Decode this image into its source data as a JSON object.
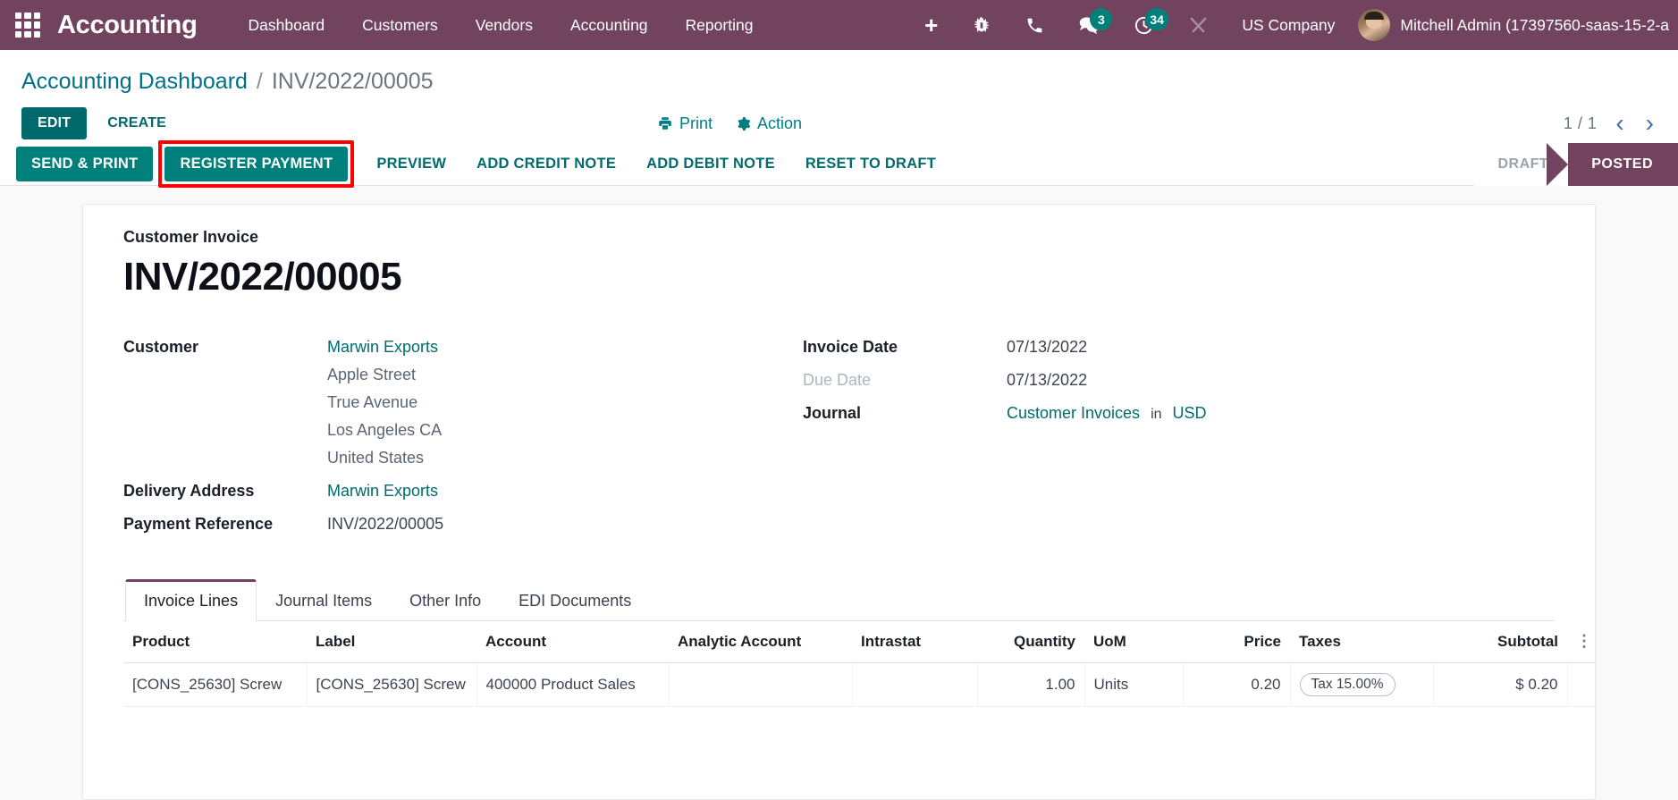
{
  "navbar": {
    "apps_icon": "apps-grid-icon",
    "brand": "Accounting",
    "menu": [
      {
        "label": "Dashboard"
      },
      {
        "label": "Customers"
      },
      {
        "label": "Vendors"
      },
      {
        "label": "Accounting"
      },
      {
        "label": "Reporting"
      }
    ],
    "plus_label": "+",
    "icons": [
      {
        "name": "bug-icon"
      },
      {
        "name": "phone-icon"
      },
      {
        "name": "messages-icon",
        "badge": "3"
      },
      {
        "name": "activities-clock-icon",
        "badge": "34"
      },
      {
        "name": "tools-icon"
      }
    ],
    "company": "US Company",
    "user": "Mitchell Admin (17397560-saas-15-2-a",
    "accent": "#71435f",
    "badge_color": "#00807b"
  },
  "breadcrumb": {
    "root": "Accounting Dashboard",
    "separator": "/",
    "current": "INV/2022/00005"
  },
  "control_panel": {
    "edit_label": "EDIT",
    "create_label": "CREATE",
    "print_label": "Print",
    "action_label": "Action",
    "pager_value": "1 / 1",
    "pager_prev": "‹",
    "pager_next": "›"
  },
  "statusbar": {
    "buttons": [
      {
        "label": "SEND & PRINT",
        "style": "primary",
        "highlighted": false
      },
      {
        "label": "REGISTER PAYMENT",
        "style": "primary",
        "highlighted": true
      },
      {
        "label": "PREVIEW",
        "style": "link",
        "highlighted": false
      },
      {
        "label": "ADD CREDIT NOTE",
        "style": "link",
        "highlighted": false
      },
      {
        "label": "ADD DEBIT NOTE",
        "style": "link",
        "highlighted": false
      },
      {
        "label": "RESET TO DRAFT",
        "style": "link",
        "highlighted": false
      }
    ],
    "stages": [
      {
        "label": "DRAFT",
        "active": false
      },
      {
        "label": "POSTED",
        "active": true
      }
    ],
    "highlight_color": "#ff0000"
  },
  "record": {
    "subtitle": "Customer Invoice",
    "title": "INV/2022/00005",
    "customer_label": "Customer",
    "customer_name": "Marwin Exports",
    "customer_address": [
      "Apple Street",
      "True Avenue",
      "Los Angeles CA",
      "United States"
    ],
    "delivery_address_label": "Delivery Address",
    "delivery_address_value": "Marwin Exports",
    "payment_reference_label": "Payment Reference",
    "payment_reference_value": "INV/2022/00005",
    "invoice_date_label": "Invoice Date",
    "invoice_date_value": "07/13/2022",
    "due_date_label": "Due Date",
    "due_date_value": "07/13/2022",
    "journal_label": "Journal",
    "journal_value": "Customer Invoices",
    "journal_in": "in",
    "journal_currency": "USD"
  },
  "tabs": [
    {
      "label": "Invoice Lines",
      "active": true
    },
    {
      "label": "Journal Items",
      "active": false
    },
    {
      "label": "Other Info",
      "active": false
    },
    {
      "label": "EDI Documents",
      "active": false
    }
  ],
  "lines_table": {
    "columns": [
      "Product",
      "Label",
      "Account",
      "Analytic Account",
      "Intrastat",
      "Quantity",
      "UoM",
      "Price",
      "Taxes",
      "Subtotal"
    ],
    "rows": [
      {
        "product": "[CONS_25630] Screw",
        "label": "[CONS_25630] Screw",
        "account": "400000 Product Sales",
        "analytic_account": "",
        "intrastat": "",
        "quantity": "1.00",
        "uom": "Units",
        "price": "0.20",
        "taxes": "Tax 15.00%",
        "subtotal": "$ 0.20"
      }
    ],
    "options_icon": "vertical-dots-icon"
  }
}
